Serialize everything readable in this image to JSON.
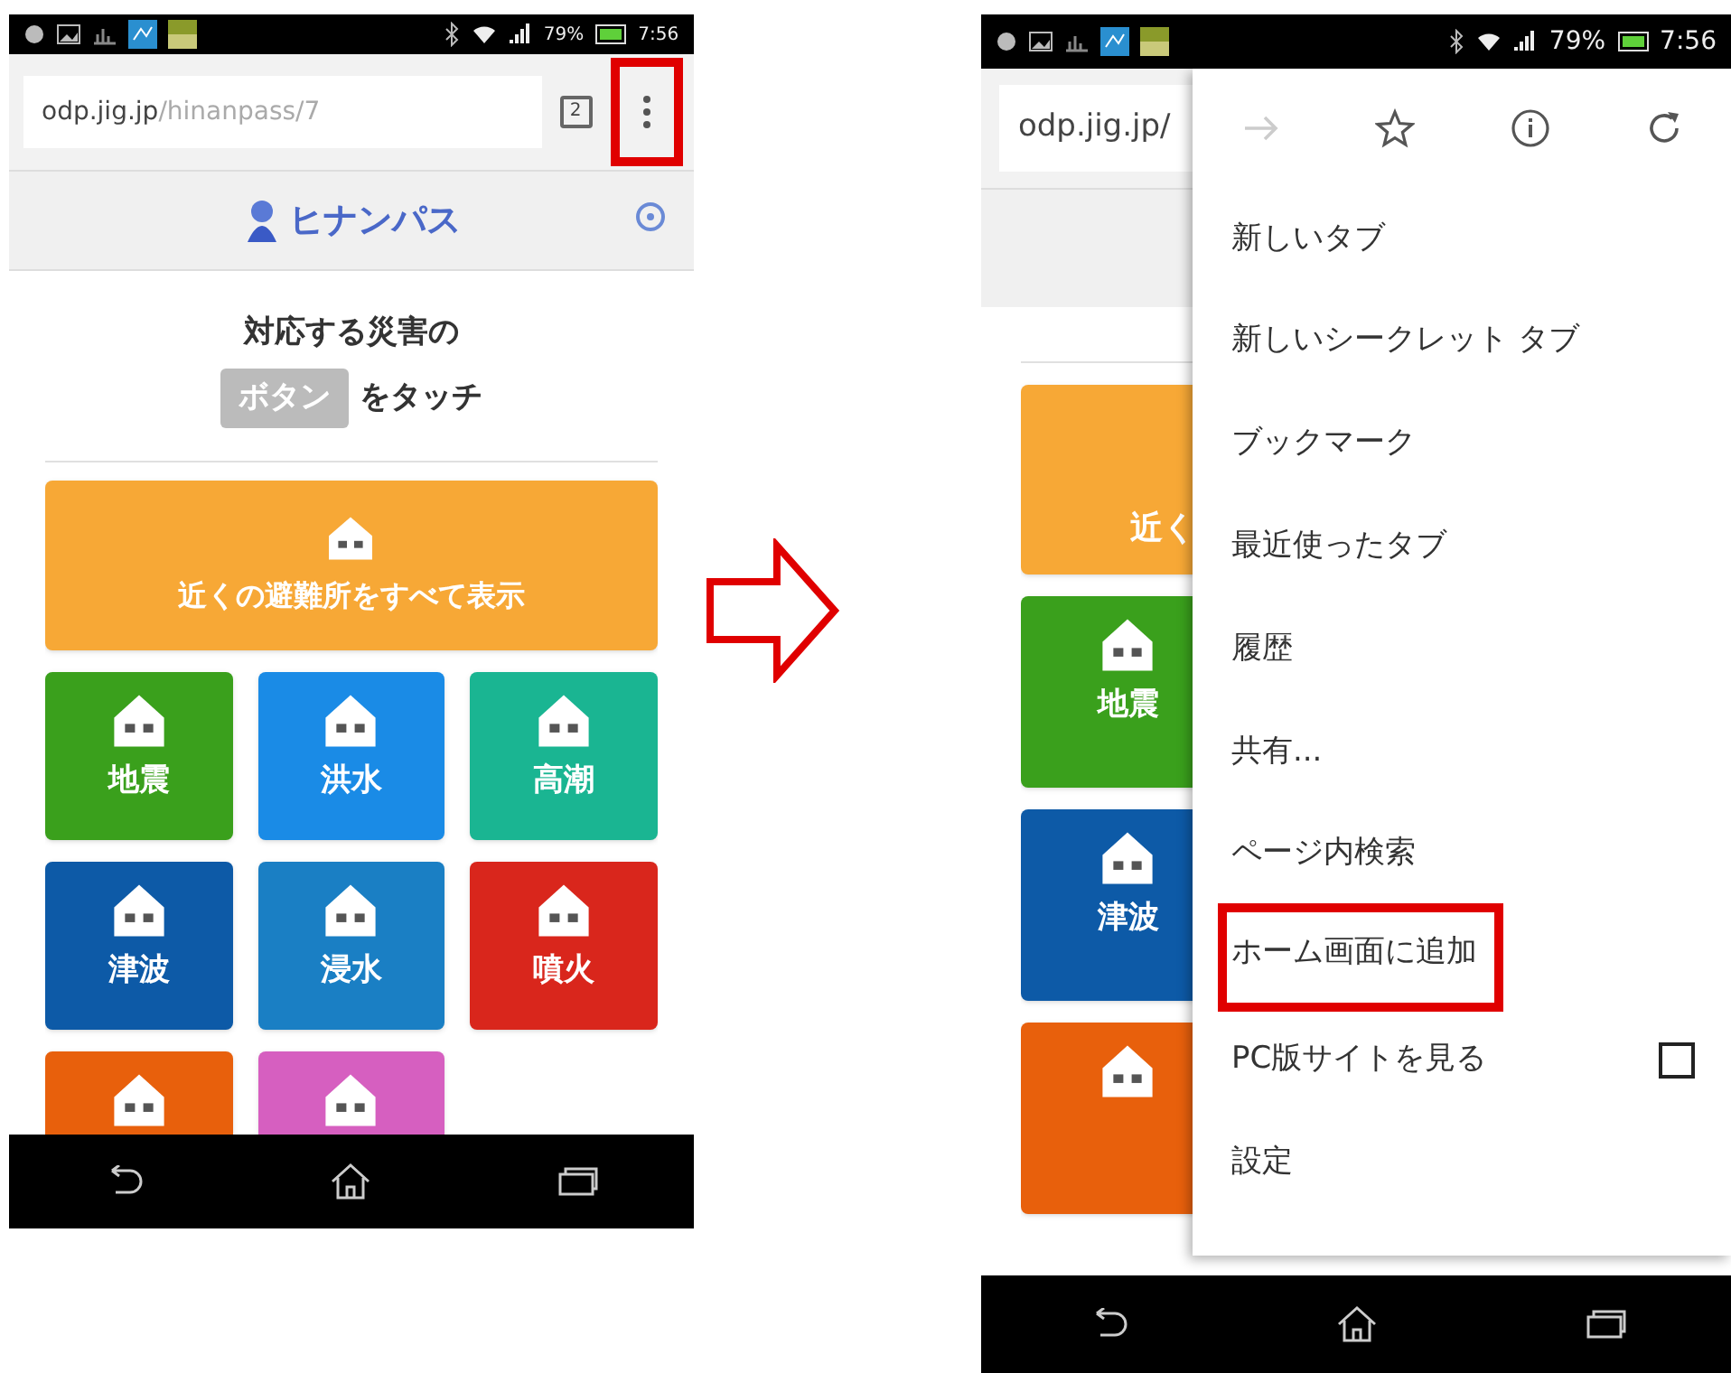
{
  "screens": [
    {
      "status_bar": {
        "battery": "79%",
        "time": "7:56"
      },
      "address_bar": {
        "host": "odp.jig.jp",
        "path": "/hinanpass/7",
        "tab_count": "2",
        "menu_button_highlighted": true
      },
      "site_header": {
        "logo": "ヒナンパス"
      },
      "instruction": {
        "line_1": "対応する災害の",
        "chip": "ボタン",
        "line_2": "をタッチ"
      },
      "nearby_button": "近くの避難所をすべて表示",
      "disaster_tiles": [
        {
          "label": "地震",
          "color": "#3aa01c"
        },
        {
          "label": "洪水",
          "color": "#1a8be6"
        },
        {
          "label": "高潮",
          "color": "#1ab592"
        },
        {
          "label": "津波",
          "color": "#0d5aa7"
        },
        {
          "label": "浸水",
          "color": "#1a7fc4"
        },
        {
          "label": "噴火",
          "color": "#d9261c"
        },
        {
          "color": "#e8600c"
        },
        {
          "color": "#d65fc0"
        }
      ]
    },
    {
      "status_bar": {
        "battery": "79%",
        "time": "7:56"
      },
      "address_bar": {
        "host": "odp.jig.jp/"
      },
      "nearby_button": "近く",
      "disaster_tiles": [
        {
          "label": "地震",
          "color": "#3aa01c"
        },
        {
          "label": "津波",
          "color": "#0d5aa7"
        },
        {
          "color": "#e8600c"
        }
      ],
      "menu": {
        "forward_disabled": true,
        "items": [
          {
            "kind": "item",
            "label": "新しいタブ",
            "highlighted": false
          },
          {
            "kind": "item",
            "label": "新しいシークレット タブ",
            "highlighted": false
          },
          {
            "kind": "item",
            "label": "ブックマーク",
            "highlighted": false
          },
          {
            "kind": "item",
            "label": "最近使ったタブ",
            "highlighted": false
          },
          {
            "kind": "item",
            "label": "履歴",
            "highlighted": false
          },
          {
            "kind": "item",
            "label": "共有...",
            "highlighted": false
          },
          {
            "kind": "item",
            "label": "ページ内検索",
            "highlighted": false
          },
          {
            "kind": "item",
            "label": "ホーム画面に追加",
            "highlighted": true
          },
          {
            "kind": "checkbox",
            "label": "PC版サイトを見る",
            "checked": false,
            "highlighted": false
          },
          {
            "kind": "item",
            "label": "設定",
            "highlighted": false
          }
        ]
      }
    }
  ]
}
